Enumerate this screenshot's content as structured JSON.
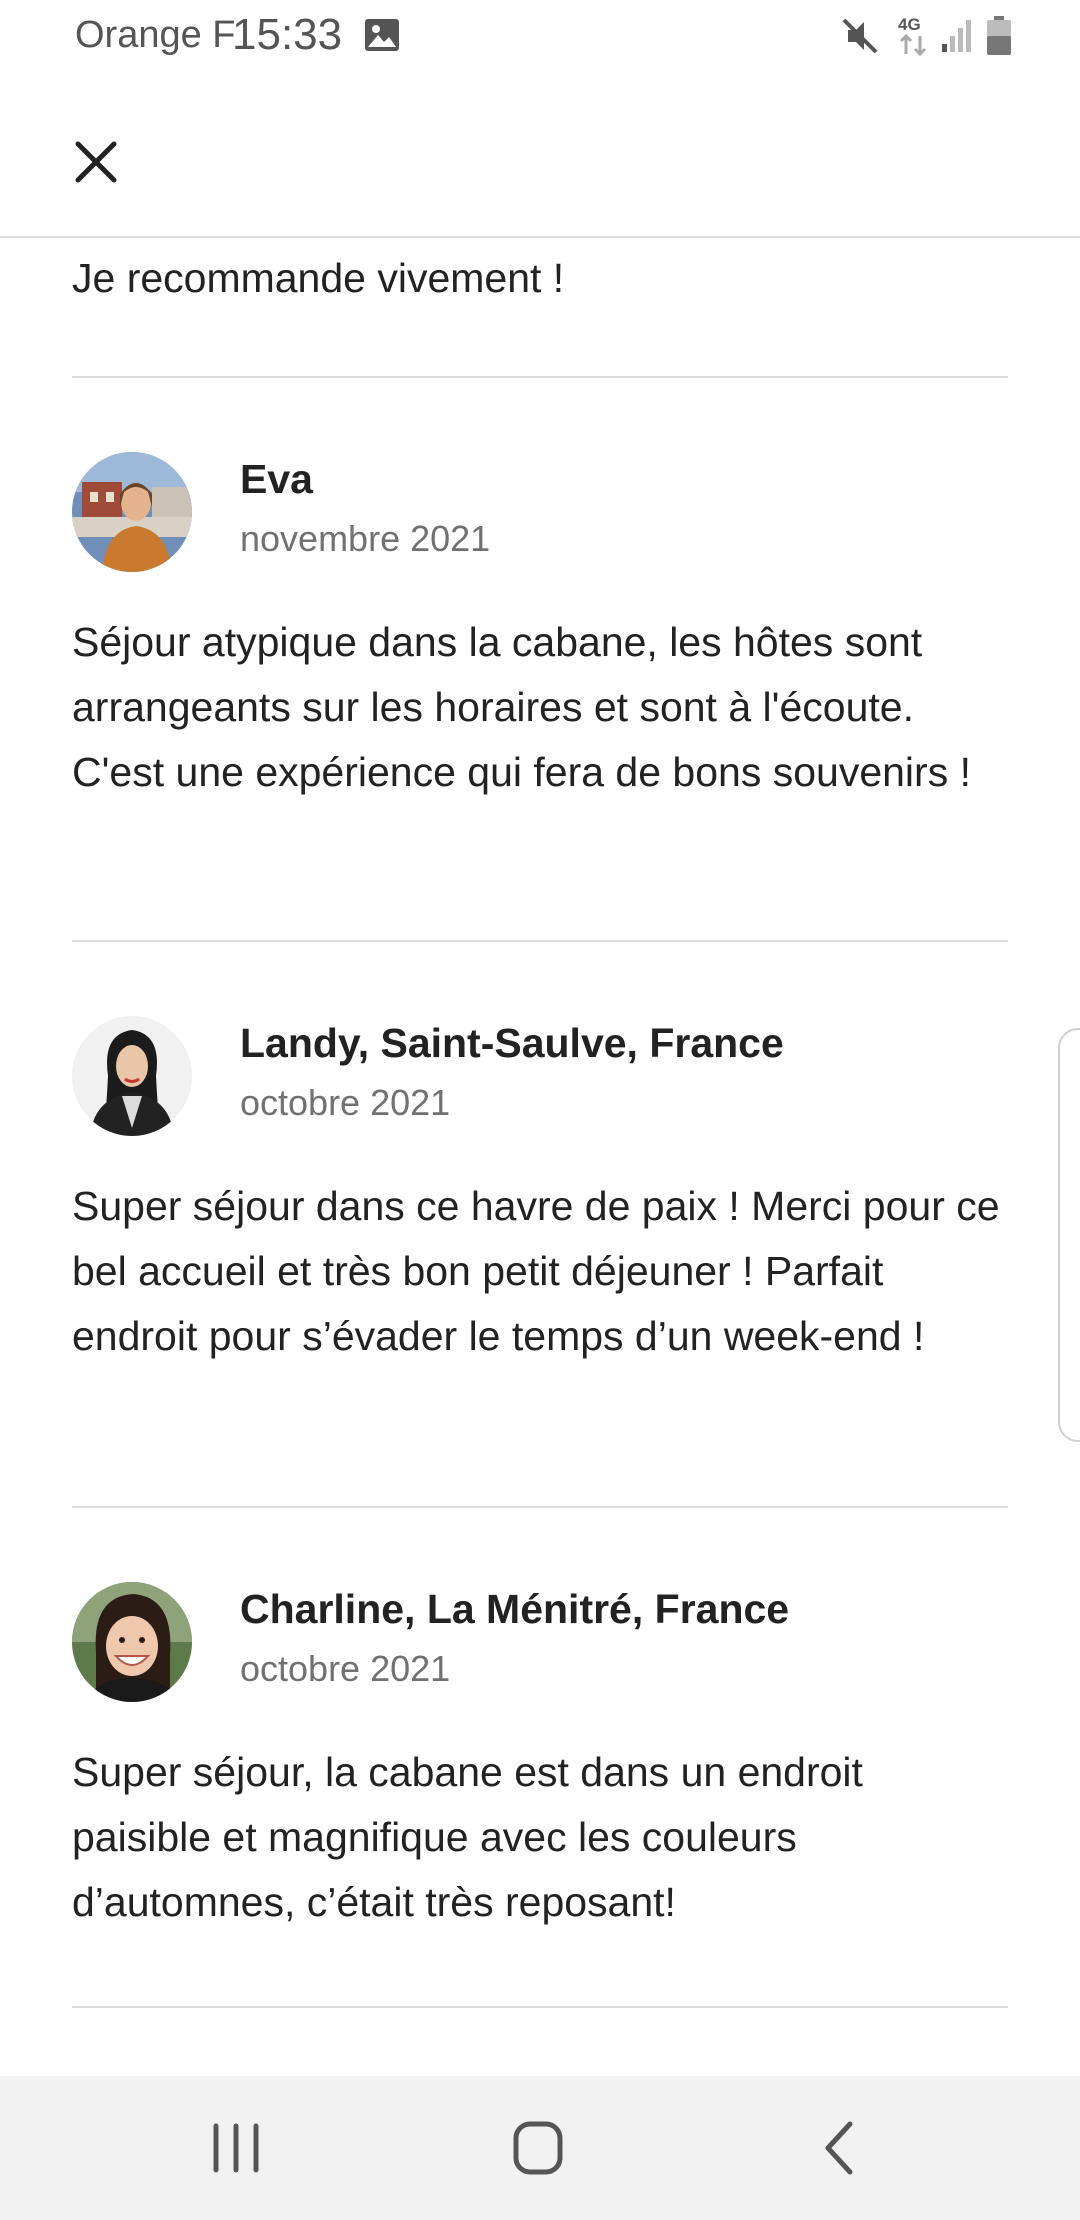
{
  "status_bar": {
    "carrier": "Orange F",
    "time": "15:33",
    "network": "4G",
    "icons": [
      "gallery-icon",
      "mute-icon",
      "network-4g-icon",
      "signal-icon",
      "battery-icon"
    ]
  },
  "top_bar": {
    "close_icon": "close-icon"
  },
  "reviews": {
    "previous_tail": "Je recommande vivement !",
    "items": [
      {
        "name": "Eva",
        "date": "novembre 2021",
        "text": "Séjour atypique dans la cabane, les hôtes sont arrangeants sur les horaires et sont à l'écoute. C'est une expérience qui fera de bons souvenirs !"
      },
      {
        "name": "Landy, Saint-Saulve, France",
        "date": "octobre 2021",
        "text": "Super séjour dans ce havre de paix ! Merci pour ce bel accueil et très bon petit déjeuner ! Parfait endroit pour s’évader le temps d’un week-end !"
      },
      {
        "name": "Charline, La Ménitré, France",
        "date": "octobre 2021",
        "text": "Super séjour, la cabane est dans un endroit paisible et magnifique avec les couleurs d’automnes, c’était très reposant!"
      }
    ]
  },
  "nav_bar": {
    "icons": [
      "recent-apps-icon",
      "home-icon",
      "back-icon"
    ]
  },
  "colors": {
    "text": "#222222",
    "secondary_text": "#717171",
    "divider": "#dddddd",
    "nav_background": "#f2f2f2"
  }
}
